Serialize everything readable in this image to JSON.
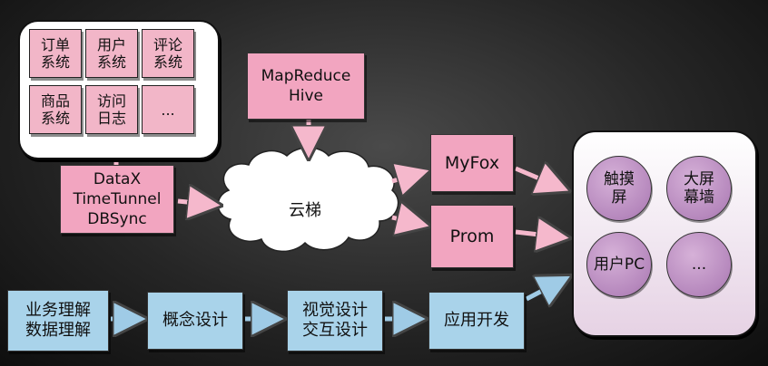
{
  "sources": {
    "items": [
      {
        "label": "订单\n系统"
      },
      {
        "label": "用户\n系统"
      },
      {
        "label": "评论\n系统"
      },
      {
        "label": "商品\n系统"
      },
      {
        "label": "访问\n日志"
      },
      {
        "label": "..."
      }
    ]
  },
  "ingest": {
    "label": "DataX\nTimeTunnel\nDBSync"
  },
  "compute": {
    "label": "MapReduce\nHive"
  },
  "cloud": {
    "label": "云梯"
  },
  "serving": {
    "myfox": "MyFox",
    "prom": "Prom"
  },
  "displays": {
    "items": [
      {
        "label": "触摸\n屏"
      },
      {
        "label": "大屏\n幕墙"
      },
      {
        "label": "用户PC"
      },
      {
        "label": "..."
      }
    ]
  },
  "process": {
    "steps": [
      {
        "label": "业务理解\n数据理解"
      },
      {
        "label": "概念设计"
      },
      {
        "label": "视觉设计\n交互设计"
      },
      {
        "label": "应用开发"
      }
    ]
  },
  "colors": {
    "pink": "#f2a5c0",
    "blue": "#a9d3ea",
    "purple": "#b688bd",
    "arrow_pink": "#f5b8cc",
    "arrow_blue": "#9fcbe6"
  }
}
